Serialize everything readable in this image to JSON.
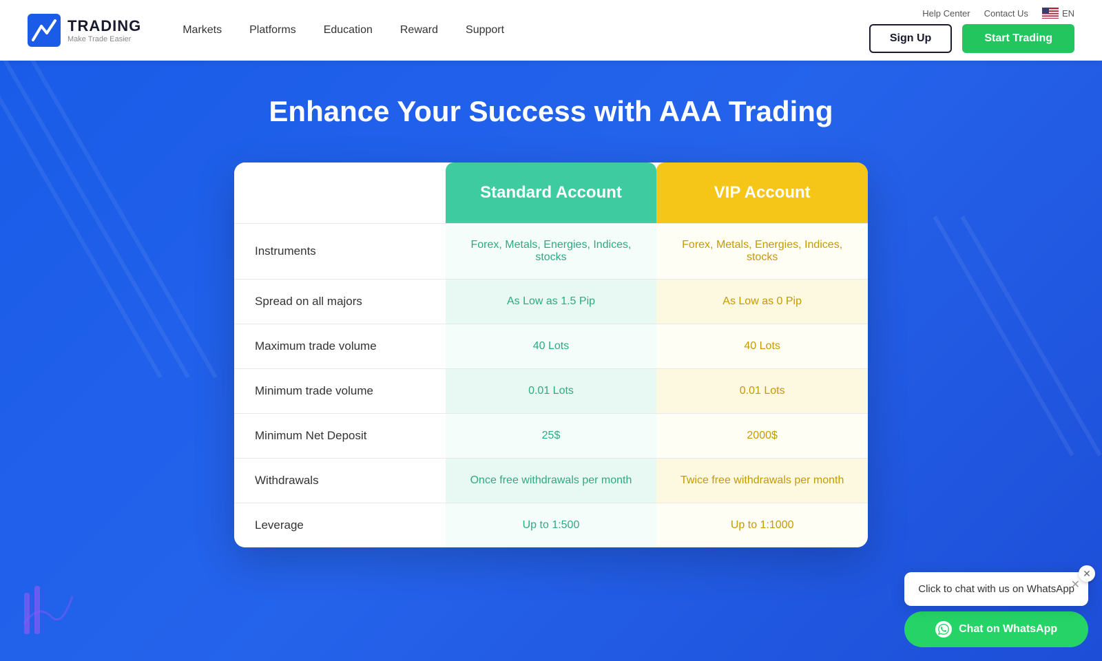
{
  "header": {
    "logo_title": "TRADING",
    "logo_sub": "Make Trade Easier",
    "nav_items": [
      "Markets",
      "Platforms",
      "Education",
      "Reward",
      "Support"
    ],
    "top_links": {
      "help": "Help Center",
      "contact": "Contact Us",
      "lang": "EN"
    },
    "btn_signup": "Sign Up",
    "btn_start": "Start Trading"
  },
  "main": {
    "title": "Enhance Your Success with AAA Trading",
    "table": {
      "col_standard": "Standard Account",
      "col_vip": "VIP Account",
      "rows": [
        {
          "label": "Instruments",
          "standard": "Forex, Metals, Energies, Indices, stocks",
          "vip": "Forex, Metals, Energies, Indices, stocks"
        },
        {
          "label": "Spread on all majors",
          "standard": "As Low as 1.5 Pip",
          "vip": "As Low as 0 Pip"
        },
        {
          "label": "Maximum trade volume",
          "standard": "40 Lots",
          "vip": "40 Lots"
        },
        {
          "label": "Minimum trade volume",
          "standard": "0.01 Lots",
          "vip": "0.01 Lots"
        },
        {
          "label": "Minimum Net Deposit",
          "standard": "25$",
          "vip": "2000$"
        },
        {
          "label": "Withdrawals",
          "standard": "Once free withdrawals per month",
          "vip": "Twice free withdrawals per month"
        },
        {
          "label": "Leverage",
          "standard": "Up to 1:500",
          "vip": "Up to 1:1000"
        }
      ]
    }
  },
  "whatsapp": {
    "tooltip_text": "Click to chat with us on WhatsApp",
    "btn_label": "Chat on WhatsApp"
  }
}
